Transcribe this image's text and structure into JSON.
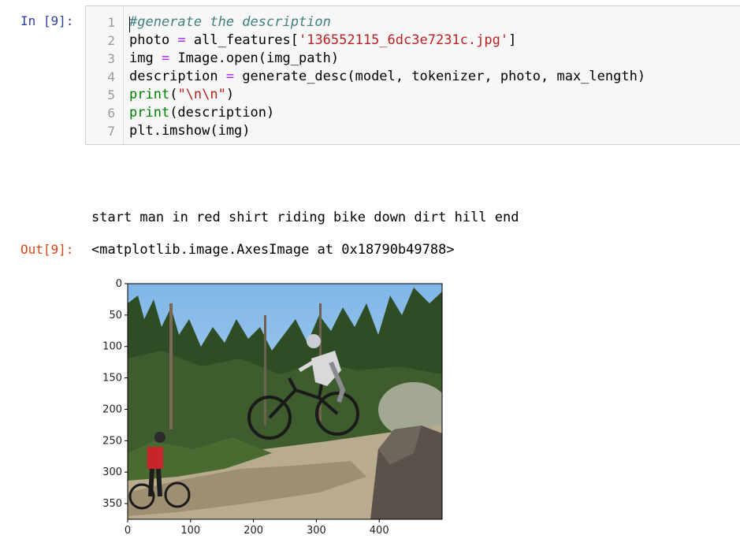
{
  "cell": {
    "in_prompt": "In [9]:",
    "out_prompt": "Out[9]:",
    "lines": [
      {
        "number": "1",
        "tokens": [
          {
            "t": "#generate the description",
            "c": "c-comment"
          }
        ]
      },
      {
        "number": "2",
        "tokens": [
          {
            "t": "photo "
          },
          {
            "t": "=",
            "c": "c-op"
          },
          {
            "t": " all_features["
          },
          {
            "t": "'136552115_6dc3e7231c.jpg'",
            "c": "c-str"
          },
          {
            "t": "]"
          }
        ]
      },
      {
        "number": "3",
        "tokens": [
          {
            "t": "img "
          },
          {
            "t": "=",
            "c": "c-op"
          },
          {
            "t": " Image.open(img_path)"
          }
        ]
      },
      {
        "number": "4",
        "tokens": [
          {
            "t": "description "
          },
          {
            "t": "=",
            "c": "c-op"
          },
          {
            "t": " generate_desc(model, tokenizer, photo, max_length)"
          }
        ]
      },
      {
        "number": "5",
        "tokens": [
          {
            "t": "print",
            "c": "c-builtin"
          },
          {
            "t": "("
          },
          {
            "t": "\"\\n\\n\"",
            "c": "c-str"
          },
          {
            "t": ")"
          }
        ]
      },
      {
        "number": "6",
        "tokens": [
          {
            "t": "print",
            "c": "c-builtin"
          },
          {
            "t": "(description)"
          }
        ]
      },
      {
        "number": "7",
        "tokens": [
          {
            "t": "plt.imshow(img)"
          }
        ]
      }
    ]
  },
  "output": {
    "stdout": "start man in red shirt riding bike down dirt hill end",
    "result": "<matplotlib.image.AxesImage at 0x18790b49788>"
  },
  "plot": {
    "image_name": "mountain-bike-jump-photo",
    "xticks": [
      "0",
      "100",
      "200",
      "300",
      "400"
    ],
    "yticks": [
      "0",
      "50",
      "100",
      "150",
      "200",
      "250",
      "300",
      "350"
    ],
    "xlim": [
      0,
      500
    ],
    "ylim": [
      375,
      0
    ],
    "colors": {
      "sky": "#9ec8ea",
      "trees": "#2f4d24",
      "dirt": "#b9ab8e",
      "rock": "#5a524a",
      "rider_red": "#c8252a"
    }
  }
}
